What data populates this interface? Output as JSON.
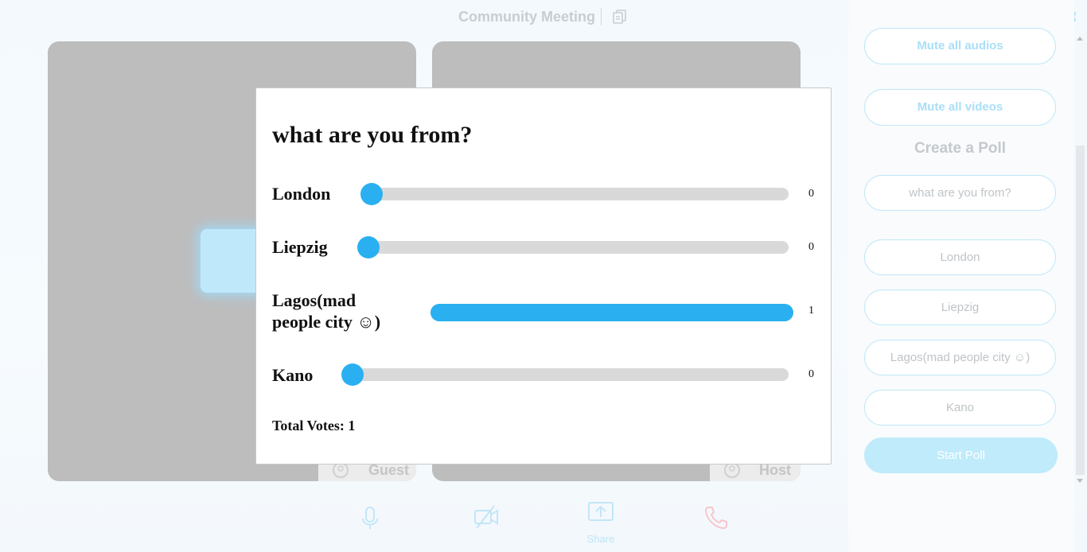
{
  "header": {
    "meeting_title": "Community Meeting",
    "icons": [
      "copy-icon",
      "participants-icon",
      "chat-icon",
      "layout-icon",
      "settings-icon"
    ]
  },
  "tiles": [
    {
      "name": "Guest",
      "icon": "user-icon"
    },
    {
      "name": "Host",
      "icon": "user-icon"
    }
  ],
  "panel": {
    "mute_audios": "Mute all audios",
    "mute_videos": "Mute all videos",
    "create_poll_heading": "Create a Poll",
    "question_placeholder": "what are you from?",
    "options": [
      "London",
      "Liepzig",
      "Lagos(mad people city ☺)",
      "Kano"
    ],
    "start_poll": "Start Poll"
  },
  "toolbar": {
    "items": [
      "mic-icon",
      "video-off-icon",
      "share-icon",
      "phone-icon"
    ],
    "share_label": "Share"
  },
  "poll": {
    "question": "what are you from?",
    "options": [
      {
        "label": "London",
        "votes": "0",
        "fraction": 0
      },
      {
        "label": "Liepzig",
        "votes": "0",
        "fraction": 0
      },
      {
        "label": "Lagos(mad people city ☺)",
        "votes": "1",
        "fraction": 1
      },
      {
        "label": "Kano",
        "votes": "0",
        "fraction": 0
      }
    ],
    "total_votes": "Total Votes: 1"
  },
  "colors": {
    "accent": "#2ab0f0",
    "track": "#d9d9d9",
    "tile": "#bdbdbd",
    "pill_border": "#bfe7f8"
  }
}
